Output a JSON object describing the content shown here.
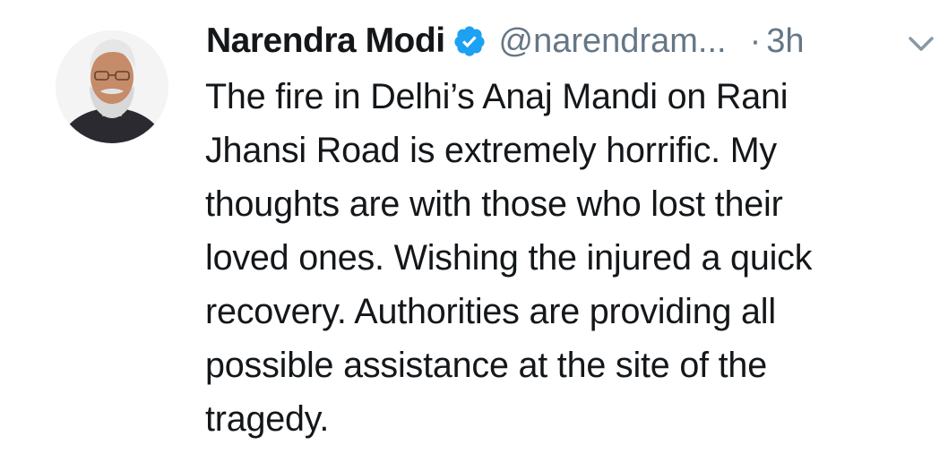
{
  "tweet": {
    "author": {
      "display_name": "Narendra Modi",
      "handle": "@narendram...",
      "verified": true,
      "avatar_icon": "profile-photo"
    },
    "separator": "·",
    "timestamp": "3h",
    "menu_icon": "chevron-down-icon",
    "text_lines": [
      "The fire in Delhi’s Anaj Mandi on Rani",
      "Jhansi Road is extremely horrific. My",
      "thoughts are with those who lost their",
      "loved ones. Wishing the injured a quick",
      "recovery. Authorities are providing all",
      "possible assistance at the site of the",
      "tragedy."
    ]
  },
  "colors": {
    "text_primary": "#14171a",
    "text_secondary": "#657786",
    "verified_blue": "#1da1f2",
    "background": "#ffffff"
  }
}
